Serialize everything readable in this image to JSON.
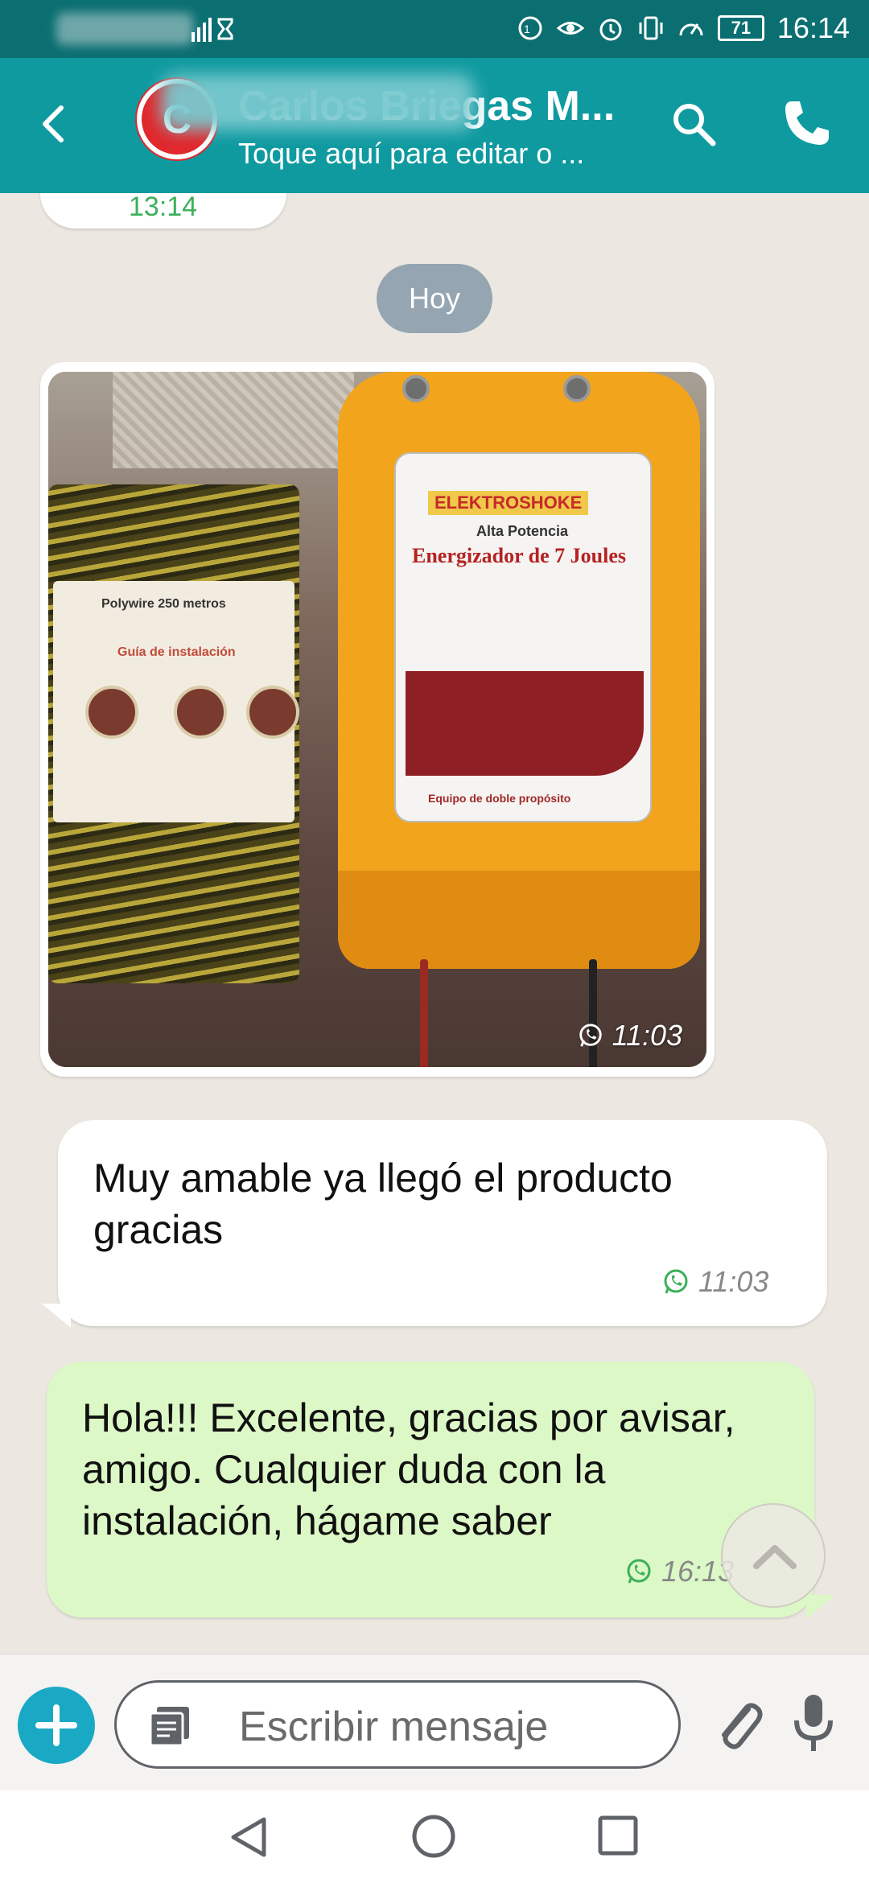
{
  "status_bar": {
    "time": "16:14",
    "battery": "71"
  },
  "header": {
    "contact_name": "Carlos Briegas M...",
    "avatar_letter": "C",
    "subtitle": "Toque aquí para editar o ..."
  },
  "chat": {
    "previous_time": "13:14",
    "date_chip": "Hoy",
    "image_message": {
      "time": "11:03",
      "spool_label_title": "Polywire 250 metros",
      "spool_label_sub": "Guía de instalación",
      "energizer_brand": "ELEKTROSHOKE",
      "energizer_sub": "Alta Potencia",
      "energizer_title": "Energizador de 7 Joules",
      "energizer_footer": "Equipo de doble propósito"
    },
    "incoming": {
      "text": "Muy amable ya llegó el producto gracias",
      "time": "11:03"
    },
    "outgoing": {
      "text": "Hola!!! Excelente, gracias por avisar, amigo. Cualquier duda con la instalación, hágame saber",
      "time": "16:13"
    }
  },
  "composer": {
    "placeholder": "Escribir mensaje"
  },
  "colors": {
    "status_bar": "#0b6f72",
    "app_bar": "#0f9aa0",
    "outgoing_bubble": "#dcf8c6",
    "accent_blue": "#1aa9c5",
    "whatsapp_green": "#3cb05a"
  },
  "icons": [
    "back-arrow-icon",
    "search-icon",
    "phone-icon",
    "whatsapp-icon",
    "plus-icon",
    "note-icon",
    "paperclip-icon",
    "mic-icon",
    "chevron-up-icon",
    "nav-back-icon",
    "nav-home-icon",
    "nav-recent-icon"
  ]
}
